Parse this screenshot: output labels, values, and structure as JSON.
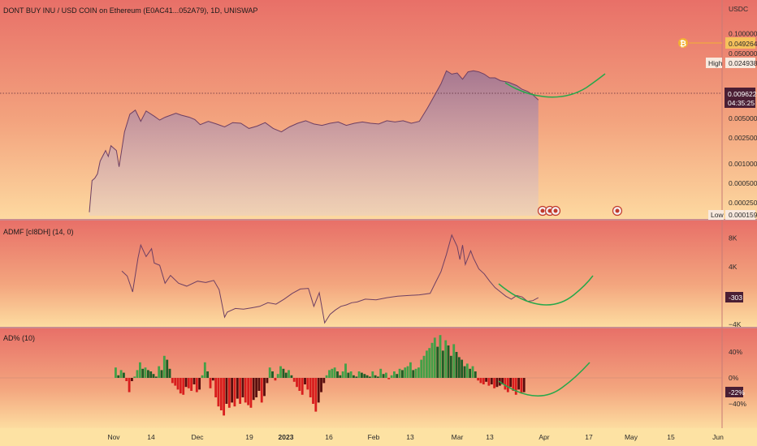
{
  "title": "DONT BUY INU / USD COIN on Ethereum (E0AC41...052A79), 1D, UNISWAP",
  "currency_label": "USDC",
  "price_badges": {
    "btc_level": "0.049264",
    "high_label": "High",
    "high_value": "0.024938",
    "current_value": "0.009622",
    "countdown": "04:35:25",
    "low_label": "Low",
    "low_value": "0.000159"
  },
  "indicators": {
    "admf_label": "ADMF [cI8DH] (14, 0)",
    "admf_value": "-303",
    "ad_label": "AD% (10)",
    "ad_value": "-22%"
  },
  "colors": {
    "bg_top": "#e7716a",
    "bg_bottom": "#fde2a0",
    "price_line": "#6e3f63",
    "curve": "#27a84a",
    "bar_up": "#43a047",
    "bar_up_dark": "#1f5e27",
    "bar_down": "#d81e1e",
    "bar_down_dark": "#5a0e0e",
    "btc_accent": "#f2b133"
  },
  "icons": [
    "bitcoin-icon",
    "event-marker-icon"
  ],
  "chart_data": [
    {
      "type": "area",
      "scale": "log",
      "yticks": [
        "0.100000",
        "0.050000",
        "0.024938",
        "0.009622",
        "0.005000",
        "0.002500",
        "0.001000",
        "0.000500",
        "0.000250",
        "0.000159"
      ],
      "ylim": [
        0.000159,
        0.14
      ],
      "x": [
        0,
        1,
        2,
        3,
        4,
        6,
        7,
        8,
        10,
        11,
        13,
        15,
        17,
        19,
        21,
        24,
        26,
        28,
        32,
        34,
        37,
        39,
        41,
        44,
        47,
        50,
        53,
        56,
        59,
        62,
        65,
        68,
        71,
        74,
        77,
        80,
        83,
        86,
        89,
        92,
        95,
        98,
        101,
        104,
        107,
        110,
        113,
        116,
        119,
        122,
        125,
        128,
        130,
        132,
        134,
        136,
        138,
        140,
        142,
        144,
        146,
        148,
        150,
        152,
        155,
        158,
        160,
        162,
        164,
        166
      ],
      "values": [
        0.00018,
        0.00055,
        0.0006,
        0.0007,
        0.0011,
        0.0016,
        0.0013,
        0.0019,
        0.0016,
        0.0009,
        0.0031,
        0.0058,
        0.0067,
        0.0045,
        0.0065,
        0.0054,
        0.0047,
        0.0052,
        0.006,
        0.0056,
        0.0052,
        0.0048,
        0.004,
        0.0045,
        0.0041,
        0.0037,
        0.0043,
        0.0042,
        0.0035,
        0.0038,
        0.0043,
        0.0035,
        0.0031,
        0.0037,
        0.0042,
        0.0046,
        0.0041,
        0.0039,
        0.0042,
        0.0044,
        0.0039,
        0.0042,
        0.0044,
        0.0042,
        0.0041,
        0.0046,
        0.0044,
        0.0046,
        0.0042,
        0.0045,
        0.0072,
        0.012,
        0.017,
        0.027,
        0.024,
        0.025,
        0.02,
        0.026,
        0.027,
        0.026,
        0.024,
        0.021,
        0.021,
        0.019,
        0.018,
        0.016,
        0.014,
        0.013,
        0.0115,
        0.009622
      ]
    },
    {
      "type": "line",
      "name": "ADMF",
      "ylim": [
        -4000,
        9500
      ],
      "yticks": [
        "8K",
        "4K",
        "-303",
        "-4K"
      ],
      "x": [
        12,
        14,
        16,
        18,
        19,
        21,
        23,
        24,
        26,
        28,
        30,
        33,
        36,
        40,
        43,
        46,
        48,
        50,
        51,
        54,
        57,
        60,
        63,
        66,
        69,
        72,
        75,
        78,
        81,
        83,
        85,
        87,
        89,
        91,
        93,
        95,
        97,
        99,
        102,
        106,
        110,
        114,
        118,
        122,
        126,
        128,
        130,
        132,
        134,
        136,
        137,
        138,
        139,
        141,
        142,
        144,
        146,
        148,
        150,
        152,
        154,
        156,
        158,
        160,
        162,
        164,
        166
      ],
      "values": [
        3400,
        2700,
        500,
        5200,
        7000,
        5400,
        6500,
        4500,
        4200,
        1700,
        2800,
        1700,
        1300,
        2000,
        1800,
        2100,
        800,
        -3000,
        -2300,
        -1800,
        -1900,
        -1700,
        -1500,
        -1000,
        -1200,
        -500,
        300,
        900,
        1000,
        -1500,
        400,
        -3800,
        -2600,
        -2000,
        -1500,
        -1300,
        -1000,
        -900,
        -500,
        -600,
        -300,
        -100,
        0,
        100,
        300,
        1800,
        3300,
        5700,
        8400,
        6800,
        5000,
        7000,
        4300,
        6200,
        5200,
        3700,
        3000,
        2000,
        1100,
        500,
        -100,
        -500,
        0,
        -200,
        -800,
        -700,
        -303
      ]
    },
    {
      "type": "bar",
      "name": "AD%",
      "ylim": [
        -80,
        80
      ],
      "yticks": [
        "40%",
        "0%",
        "-22%",
        "-40%"
      ],
      "values": [
        16,
        4,
        12,
        8,
        -5,
        -22,
        -5,
        2,
        12,
        24,
        14,
        16,
        12,
        10,
        6,
        2,
        18,
        12,
        34,
        28,
        14,
        -8,
        -12,
        -18,
        -24,
        -26,
        -14,
        -16,
        -20,
        -10,
        -22,
        -18,
        4,
        24,
        10,
        -16,
        -4,
        -30,
        -44,
        -50,
        -58,
        -40,
        -46,
        -38,
        -44,
        -32,
        -40,
        -30,
        -38,
        -42,
        -46,
        -34,
        -30,
        -20,
        -38,
        -28,
        -8,
        16,
        10,
        -4,
        6,
        18,
        14,
        8,
        12,
        4,
        -6,
        -14,
        -20,
        -26,
        -10,
        -18,
        -30,
        -40,
        -52,
        -38,
        -22,
        -8,
        4,
        12,
        14,
        16,
        10,
        4,
        10,
        22,
        8,
        10,
        4,
        2,
        10,
        8,
        6,
        4,
        2,
        10,
        4,
        2,
        14,
        6,
        8,
        -2,
        4,
        10,
        6,
        14,
        12,
        16,
        18,
        24,
        12,
        14,
        16,
        28,
        34,
        42,
        46,
        54,
        62,
        48,
        66,
        42,
        58,
        50,
        34,
        52,
        40,
        32,
        28,
        18,
        22,
        14,
        18,
        10,
        -4,
        -8,
        -10,
        -6,
        -12,
        -10,
        -16,
        -14,
        -12,
        -10,
        -18,
        -22,
        -14,
        -20,
        -26,
        -18,
        -24,
        -22
      ]
    }
  ],
  "x_axis": {
    "labels": [
      "Nov",
      "14",
      "Dec",
      "19",
      "2023",
      "16",
      "Feb",
      "13",
      "Mar",
      "13",
      "Apr",
      "17",
      "May",
      "15",
      "Jun"
    ]
  }
}
